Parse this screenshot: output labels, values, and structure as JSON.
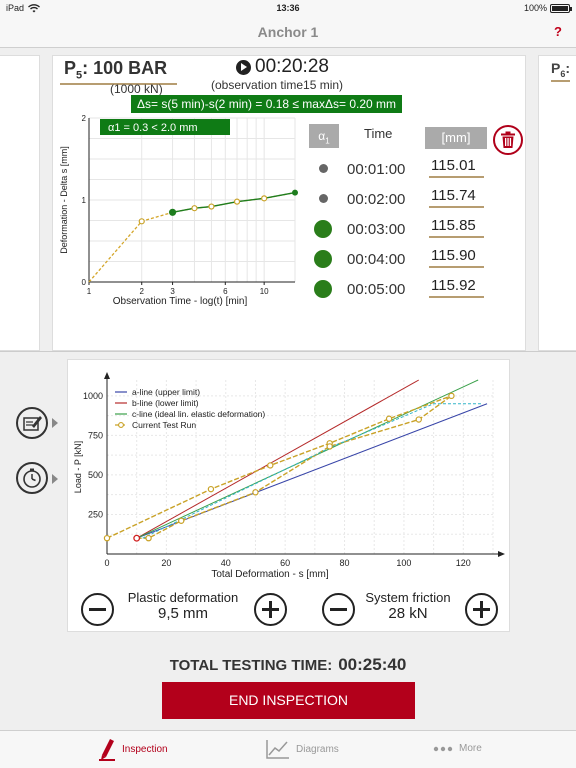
{
  "status": {
    "device": "iPad",
    "time": "13:36",
    "battery": "100%",
    "battery_level": 1.0
  },
  "nav": {
    "title": "Anchor 1",
    "help": "?"
  },
  "next_card": {
    "label_p": "P",
    "label_sub": "6",
    "label_rest": ":"
  },
  "stage": {
    "p_letter": "P",
    "p_sub": "5",
    "p_rest": ": 100 BAR",
    "kn": "(1000 kN)",
    "timer": "00:20:28",
    "observation": "(observation time15 min)",
    "delta_criterion": "Δs= s(5 min)-s(2 min) = 0.18 ≤ maxΔs= 0.20 mm"
  },
  "table": {
    "col_alpha": "α",
    "col_alpha_sub": "1",
    "col_time": "Time",
    "col_unit": "[mm]",
    "rows": [
      {
        "time": "00:01:00",
        "value": "115.01",
        "marker": "small"
      },
      {
        "time": "00:02:00",
        "value": "115.74",
        "marker": "small"
      },
      {
        "time": "00:03:00",
        "value": "115.85",
        "marker": "big"
      },
      {
        "time": "00:04:00",
        "value": "115.90",
        "marker": "big"
      },
      {
        "time": "00:05:00",
        "value": "115.92",
        "marker": "big"
      }
    ]
  },
  "chart_data": [
    {
      "type": "line",
      "title": "",
      "annotation": "α1 = 0.3 < 2.0 mm",
      "xlabel": "Observation Time - log(t) [min]",
      "ylabel": "Deformation - Delta s [mm]",
      "x_scale": "log",
      "xlim": [
        1,
        15
      ],
      "ylim": [
        0,
        2
      ],
      "xticks": [
        1,
        2,
        3,
        6,
        10
      ],
      "yticks": [
        0,
        1,
        2
      ],
      "series": [
        {
          "name": "",
          "style": "dashed-orange",
          "x": [
            1,
            2,
            3,
            4,
            5,
            7,
            10,
            15
          ],
          "y": [
            0.0,
            0.74,
            0.85,
            0.9,
            0.92,
            0.98,
            1.02,
            1.09
          ]
        },
        {
          "name": "",
          "style": "solid-green",
          "x": [
            3,
            4,
            5,
            7,
            10,
            15
          ],
          "y": [
            0.85,
            0.9,
            0.92,
            0.98,
            1.02,
            1.09
          ]
        }
      ]
    },
    {
      "type": "line",
      "title": "",
      "xlabel": "Total Deformation - s [mm]",
      "ylabel": "Load - P [kN]",
      "xlim": [
        0,
        130
      ],
      "ylim": [
        0,
        1100
      ],
      "xticks": [
        0,
        20,
        40,
        60,
        80,
        100,
        120
      ],
      "yticks": [
        250,
        500,
        750,
        1000
      ],
      "legend_position": "top-left",
      "series": [
        {
          "name": "a-line (upper limit)",
          "color": "#3845a8",
          "x": [
            10,
            128
          ],
          "y": [
            100,
            950
          ]
        },
        {
          "name": "b-line (lower limit)",
          "color": "#b52a2a",
          "x": [
            10,
            105
          ],
          "y": [
            100,
            1100
          ]
        },
        {
          "name": "c-line (ideal lin. elastic deformation)",
          "color": "#3aa04a",
          "x": [
            10,
            125
          ],
          "y": [
            100,
            1100
          ]
        },
        {
          "name": "Current Test Run",
          "color": "#c9a227",
          "x": [
            0,
            35,
            55,
            75,
            95,
            116
          ],
          "y": [
            100,
            410,
            560,
            700,
            855,
            1000
          ]
        },
        {
          "name": "",
          "color": "#c9a227",
          "x": [
            10,
            14,
            25,
            50,
            75,
            105,
            116
          ],
          "y": [
            100,
            100,
            210,
            390,
            680,
            850,
            1000
          ]
        },
        {
          "name": "",
          "color": "#33b5c9",
          "x": [
            12,
            76,
            110,
            126
          ],
          "y": [
            100,
            680,
            950,
            950
          ]
        }
      ]
    }
  ],
  "controls": {
    "plastic_label": "Plastic deformation",
    "plastic_value": "9,5 mm",
    "friction_label": "System friction",
    "friction_value": "28 kN",
    "minus": "−",
    "plus": "+"
  },
  "footer": {
    "total_label": "TOTAL TESTING TIME:",
    "total_value": "00:25:40",
    "end_button": "END INSPECTION"
  },
  "tabs": [
    {
      "label": "Inspection",
      "icon": "pencil-icon"
    },
    {
      "label": "Diagrams",
      "icon": "line-chart-icon"
    },
    {
      "label": "More",
      "icon": "ellipsis-icon"
    }
  ],
  "colors": {
    "accent": "#b3001b",
    "green": "#0f7b15",
    "gold": "#b79d71"
  }
}
